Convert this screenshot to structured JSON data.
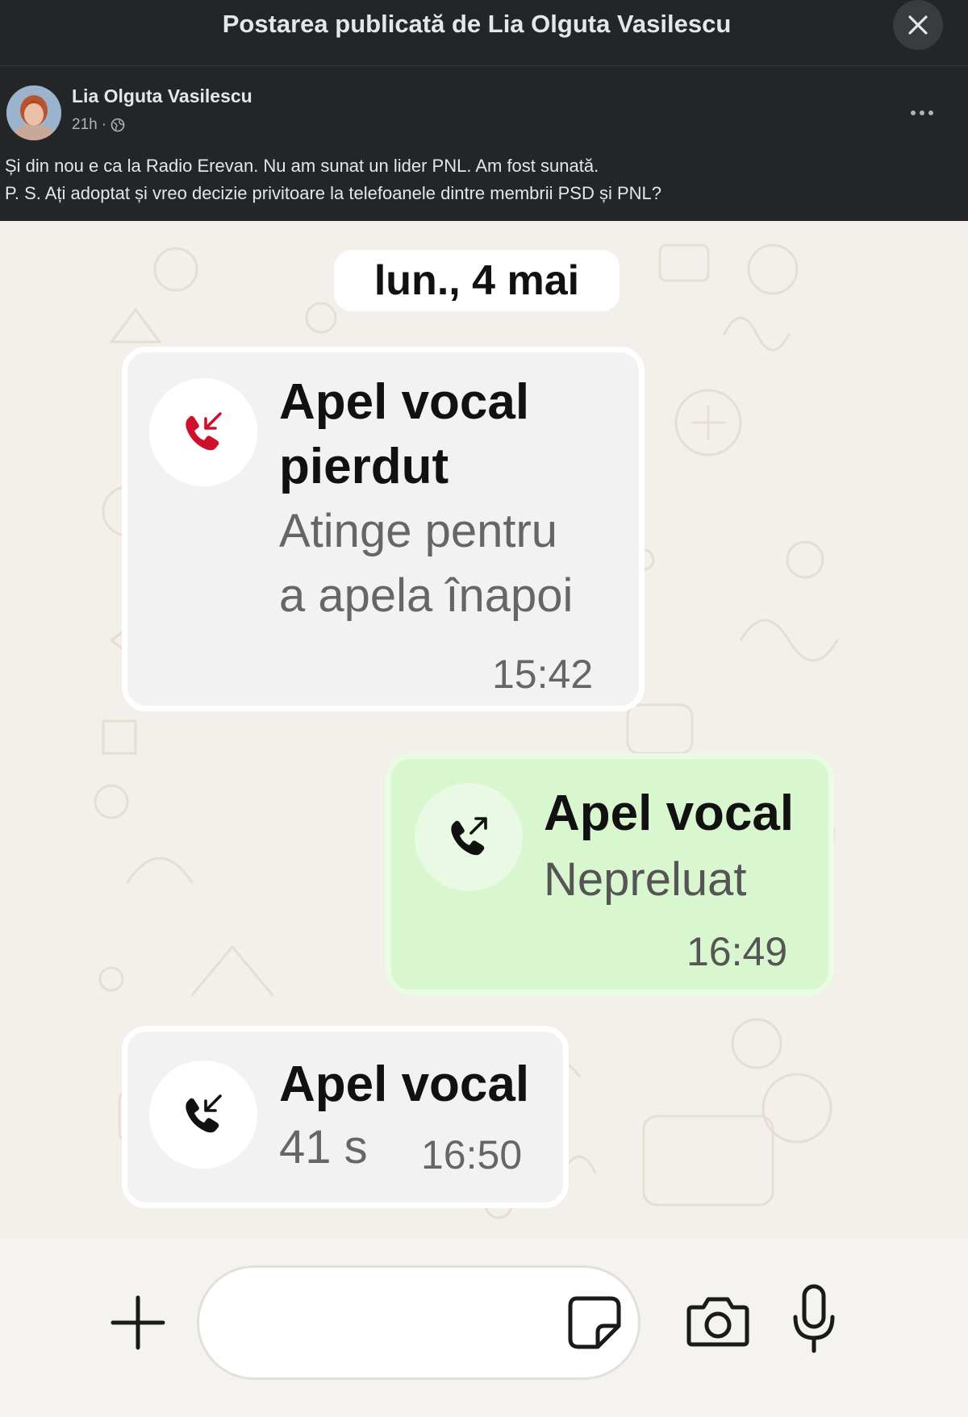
{
  "modal": {
    "title": "Postarea publicată de Lia Olguta Vasilescu",
    "close_icon": "close-icon"
  },
  "post": {
    "author": "Lia Olguta Vasilescu",
    "time": "21h",
    "separator": "·",
    "audience_icon": "globe-icon",
    "more_icon": "more-options-icon",
    "text_line_1": "Și din nou e ca la Radio Erevan. Nu am sunat un lider PNL. Am fost sunată.",
    "text_line_2": "P. S. Ați adoptat și vreo decizie privitoare la telefoanele dintre membrii PSD și PNL?"
  },
  "chat": {
    "date": "lun., 4 mai",
    "messages": [
      {
        "direction": "incoming",
        "icon": "missed-call-icon",
        "icon_color": "#d0102b",
        "title_line_1": "Apel vocal",
        "title_line_2": "pierdut",
        "subtitle_line_1": "Atinge pentru",
        "subtitle_line_2": "a apela înapoi",
        "time": "15:42"
      },
      {
        "direction": "outgoing",
        "icon": "outgoing-call-icon",
        "title": "Apel vocal",
        "subtitle": "Nepreluat",
        "time": "16:49"
      },
      {
        "direction": "incoming",
        "icon": "incoming-call-icon",
        "title": "Apel vocal",
        "subtitle": "41 s",
        "time": "16:50"
      }
    ]
  },
  "input_bar": {
    "add_icon": "plus-icon",
    "sticker_icon": "sticker-icon",
    "camera_icon": "camera-icon",
    "mic_icon": "microphone-icon"
  },
  "colors": {
    "facebook_dark": "#242526",
    "chat_background": "#f3f0eb",
    "outgoing_bubble": "#d9f7cf",
    "incoming_bubble": "#f2f2f2",
    "missed_call_red": "#d0102b"
  }
}
